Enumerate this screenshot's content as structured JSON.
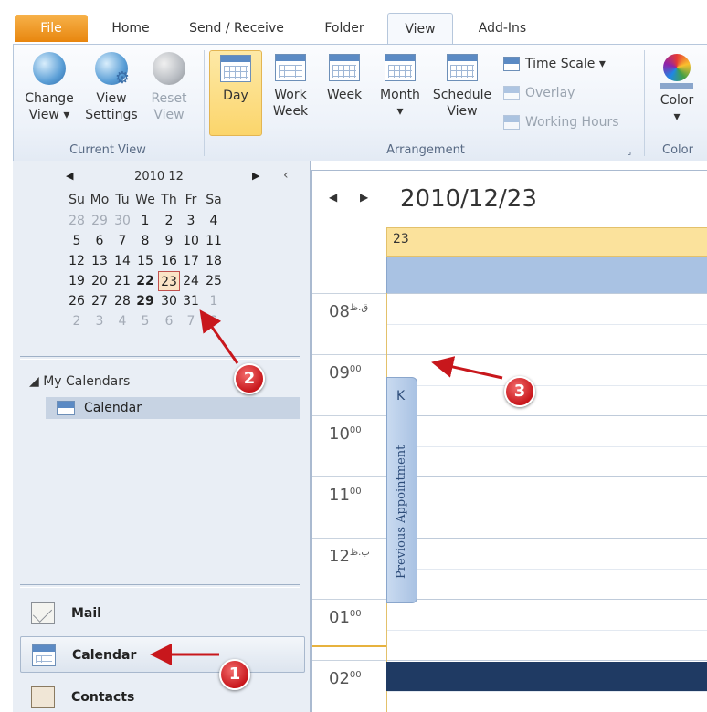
{
  "tabs": {
    "file": "File",
    "home": "Home",
    "send_receive": "Send / Receive",
    "folder": "Folder",
    "view": "View",
    "addins": "Add-Ins"
  },
  "ribbon": {
    "current_view": {
      "change_view_1": "Change",
      "change_view_2": "View ▾",
      "view_settings_1": "View",
      "view_settings_2": "Settings",
      "reset_view_1": "Reset",
      "reset_view_2": "View",
      "group_label": "Current View"
    },
    "arrangement": {
      "day": "Day",
      "work_week_1": "Work",
      "work_week_2": "Week",
      "week": "Week",
      "month_1": "Month",
      "month_2": "▾",
      "schedule_view_1": "Schedule",
      "schedule_view_2": "View",
      "time_scale": "Time Scale ▾",
      "overlay": "Overlay",
      "working_hours": "Working Hours",
      "group_label": "Arrangement",
      "launcher": "⌟"
    },
    "color": {
      "color_1": "Color",
      "color_2": "▾",
      "group_label": "Color"
    }
  },
  "mini_calendar": {
    "title": "2010 12",
    "prev": "◀",
    "next": "▶",
    "collapse": "‹",
    "days_of_week": [
      "Su",
      "Mo",
      "Tu",
      "We",
      "Th",
      "Fr",
      "Sa"
    ],
    "weeks": [
      [
        "28",
        "29",
        "30",
        "1",
        "2",
        "3",
        "4"
      ],
      [
        "5",
        "6",
        "7",
        "8",
        "9",
        "10",
        "11"
      ],
      [
        "12",
        "13",
        "14",
        "15",
        "16",
        "17",
        "18"
      ],
      [
        "19",
        "20",
        "21",
        "22",
        "23",
        "24",
        "25"
      ],
      [
        "26",
        "27",
        "28",
        "29",
        "30",
        "31",
        "1"
      ],
      [
        "2",
        "3",
        "4",
        "5",
        "6",
        "7",
        "8"
      ]
    ]
  },
  "my_calendars": {
    "header": "◢ My Calendars",
    "item": "Calendar"
  },
  "nav_buttons": {
    "mail": "Mail",
    "calendar": "Calendar",
    "contacts": "Contacts"
  },
  "view": {
    "prev": "◀",
    "next": "▶",
    "date": "2010/12/23",
    "day_header": "23",
    "hours": [
      {
        "h": "08",
        "s": "ق.ظ"
      },
      {
        "h": "09",
        "s": "00"
      },
      {
        "h": "10",
        "s": "00"
      },
      {
        "h": "11",
        "s": "00"
      },
      {
        "h": "12",
        "s": "ب.ظ"
      },
      {
        "h": "01",
        "s": "00"
      },
      {
        "h": "02",
        "s": "00"
      }
    ],
    "previous_appointment_chevron": "K",
    "previous_appointment_label": "Previous Appointment"
  },
  "callouts": [
    "1",
    "2",
    "3"
  ],
  "colors": {
    "callout_red": "#c8171c",
    "day_header_yellow": "#fbe29c",
    "appointment_navy": "#1f3a63",
    "file_tab_orange": "#e8860e"
  }
}
